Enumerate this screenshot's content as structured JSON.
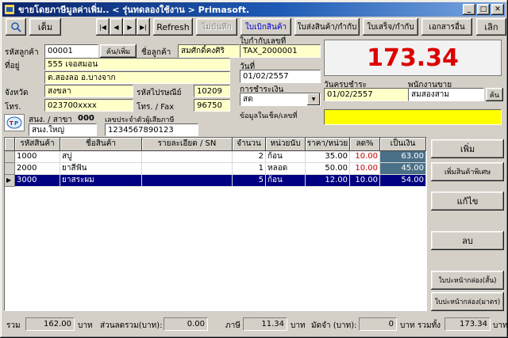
{
  "window": {
    "title": "ขายโดยภาษีมูลค่าเพิ่ม..  < รุ่นทดลองใช้งาน > Primasoft.",
    "minimize": "_",
    "maximize": "□",
    "close": "✕"
  },
  "toolbar": {
    "full": "เต็ม",
    "nav_first": "|◀",
    "nav_prev": "◀",
    "nav_next": "▶",
    "nav_last": "▶|",
    "refresh": "Refresh",
    "no_save": "ไม่บันทึก",
    "withdraw": "ใบเบิกสินค้า",
    "delivery": "ใบส่งสินค้า/กำกับ",
    "receipt": "ใบเสร็จ/กำกับ",
    "other_docs": "เอกสารอื่น",
    "exit": "เลิก"
  },
  "form": {
    "customer_code_label": "รหัสลูกค้า",
    "customer_code": "00001",
    "customer_search": "ค้น/เพิ่ม",
    "customer_name_label": "ชื่อลูกค้า",
    "customer_name": "สมศักดิ์คงศิริ",
    "invoice_label": "ใบกำกับเลขที่",
    "invoice_no": "TAX_2000001",
    "address_label": "ที่อยู่",
    "address1": "555 เจอสมอน",
    "address2": "ต.สองลอ อ.บางจาก",
    "date_label": "วันที่",
    "date": "01/02/2557",
    "province_label": "จังหวัด",
    "province": "สงขลา",
    "postcode_label": "รหัสไปรษณีย์",
    "postcode": "10209",
    "phone_label": "โทร.",
    "phone": "023700xxxx",
    "fax_label": "โทร. / Fax",
    "fax": "96750",
    "payment_label": "การชำระเงิน",
    "payment": "สด",
    "due_label": "วันครบชำระ",
    "due_date": "01/02/2557",
    "sales_label": "พนักงานขาย",
    "salesperson": "สมสองสาม",
    "sales_search": "ค้น",
    "branch_label": "สนง. / สาขา",
    "branch_code": "000",
    "branch_name": "สนง.ใหญ่",
    "taxid_label": "เลขประจำตัวผู้เสียภาษี",
    "tax_id": "1234567890123",
    "cheque_label": "ข้อมูลในเช็ค/เลขที่",
    "cheque_info": "",
    "grand_total": "173.34"
  },
  "table": {
    "columns": [
      "รหัสสินค้า",
      "ชื่อสินค้า",
      "รายละเอียด / SN",
      "จำนวน",
      "หน่วยนับ",
      "ราคา/หน่วย",
      "ลด%",
      "เป็นเงิน"
    ],
    "rows": [
      {
        "code": "1000",
        "name": "สบู่",
        "detail": "",
        "qty": "2",
        "unit": "ก้อน",
        "price": "35.00",
        "discount": "10.00",
        "amount": "63.00"
      },
      {
        "code": "2000",
        "name": "ยาสีฟัน",
        "detail": "",
        "qty": "1",
        "unit": "หลอด",
        "price": "50.00",
        "discount": "10.00",
        "amount": "45.00"
      },
      {
        "code": "3000",
        "name": "ยาสระผม",
        "detail": "",
        "qty": "5",
        "unit": "ก้อน",
        "price": "12.00",
        "discount": "10.00",
        "amount": "54.00"
      }
    ],
    "selected_index": 2
  },
  "side_buttons": {
    "add": "เพิ่ม",
    "add_special": "เพิ่มสินค้าพิเศษ",
    "edit": "แก้ไข",
    "delete": "ลบ",
    "box_label_short": "ใบปะหน้ากล่อง(สั้น)",
    "box_label_std": "ใบปะหน้ากล่อง(มาตร)"
  },
  "footer": {
    "subtotal_label": "รวม",
    "subtotal": "162.00",
    "baht1": "บาท",
    "discount_label": "ส่วนลดรวม(บาท):",
    "discount": "0.00",
    "vat_label": "ภาษี",
    "vat": "11.34",
    "baht2": "บาท",
    "deposit_label": "มัดจำ (บาท):",
    "deposit": "0",
    "baht3": "บาท",
    "total_label": "รวมทั้ง",
    "total": "173.34",
    "baht4": "บาท"
  },
  "colors": {
    "accent_yellow": "#ffff00",
    "field_cream": "#ffffc8",
    "total_red": "#dd0000",
    "selected_row": "#000080",
    "amount_cell": "#4a7087"
  }
}
